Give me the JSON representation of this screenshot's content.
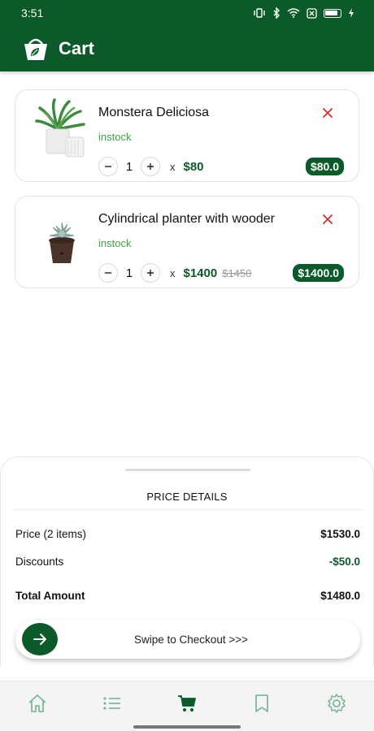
{
  "status_bar": {
    "time": "3:51"
  },
  "app_bar": {
    "title": "Cart"
  },
  "cart": {
    "items": [
      {
        "name": "Monstera Deliciosa",
        "stock": "instock",
        "qty": "1",
        "times": "x",
        "unit_price": "$80",
        "original_price": "",
        "total": "$80.0"
      },
      {
        "name": "Cylindrical planter with wooder",
        "stock": "instock",
        "qty": "1",
        "times": "x",
        "unit_price": "$1400",
        "original_price": "$1450",
        "total": "$1400.0"
      }
    ]
  },
  "summary": {
    "title": "PRICE DETAILS",
    "price_label": "Price (2 items)",
    "price_value": "$1530.0",
    "discount_label": "Discounts",
    "discount_value": "-$50.0",
    "total_label": "Total Amount",
    "total_value": "$1480.0",
    "swipe_label": "Swipe to Checkout >>>"
  },
  "bottom_nav": {
    "items": [
      {
        "icon": "home-icon",
        "active": false
      },
      {
        "icon": "list-icon",
        "active": false
      },
      {
        "icon": "cart-icon",
        "active": true
      },
      {
        "icon": "bookmark-icon",
        "active": false
      },
      {
        "icon": "gear-icon",
        "active": false
      }
    ]
  },
  "colors": {
    "brand": "#0c5a2a",
    "instock": "#3fa14a",
    "remove": "#d32f2f",
    "nav_inactive": "#7fb89a"
  }
}
